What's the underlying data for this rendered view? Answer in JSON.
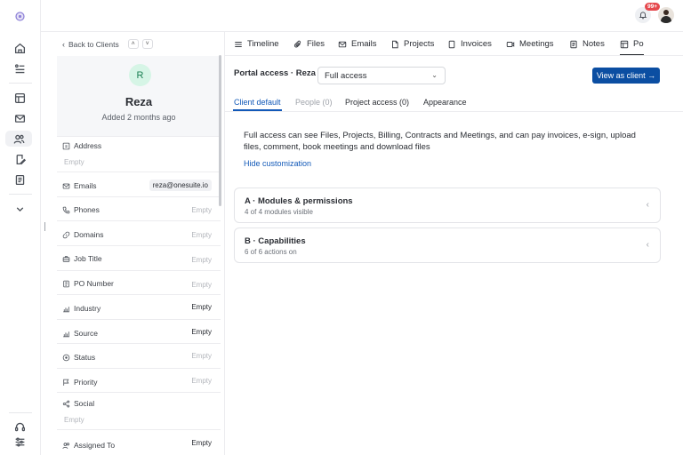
{
  "rail": {
    "icons": [
      "logo-icon",
      "home-icon",
      "tasks-icon",
      "calendar-icon",
      "mail-icon",
      "clients-icon",
      "contracts-icon",
      "documents-icon",
      "chevron-down-icon",
      "support-icon",
      "settings-icon"
    ]
  },
  "topbar": {
    "notification_count": "99+"
  },
  "left": {
    "back_label": "Back to Clients",
    "client": {
      "initial": "R",
      "name": "Reza",
      "added": "Added 2 months ago"
    },
    "fields": [
      {
        "label": "Address",
        "value": "Empty"
      },
      {
        "label": "Emails",
        "value": "reza@onesuite.io"
      },
      {
        "label": "Phones",
        "value": "Empty"
      },
      {
        "label": "Domains",
        "value": "Empty"
      },
      {
        "label": "Job Title",
        "value": "Empty"
      },
      {
        "label": "PO Number",
        "value": "Empty"
      },
      {
        "label": "Industry",
        "value": "Empty"
      },
      {
        "label": "Source",
        "value": "Empty"
      },
      {
        "label": "Status",
        "value": "Empty"
      },
      {
        "label": "Priority",
        "value": "Empty"
      },
      {
        "label": "Social",
        "value": "Empty"
      },
      {
        "label": "Assigned To",
        "value": "Empty"
      }
    ]
  },
  "tabs": [
    {
      "label": "Timeline"
    },
    {
      "label": "Files"
    },
    {
      "label": "Emails"
    },
    {
      "label": "Projects"
    },
    {
      "label": "Invoices"
    },
    {
      "label": "Meetings"
    },
    {
      "label": "Notes"
    },
    {
      "label": "Po"
    }
  ],
  "portal": {
    "label": "Portal access · Reza",
    "access_value": "Full access",
    "view_button": "View as client →",
    "subtabs": [
      "Client default",
      "People (0)",
      "Project access (0)",
      "Appearance"
    ],
    "info_text": "Full access can see Files, Projects, Billing, Contracts and Meetings, and can pay invoices, e-sign, upload files, comment, book meetings and download files",
    "hide_link": "Hide customization",
    "sections": [
      {
        "title": "A · Modules & permissions",
        "subtitle": "4 of 4 modules visible"
      },
      {
        "title": "B · Capabilities",
        "subtitle": "6 of 6 actions on"
      }
    ]
  }
}
